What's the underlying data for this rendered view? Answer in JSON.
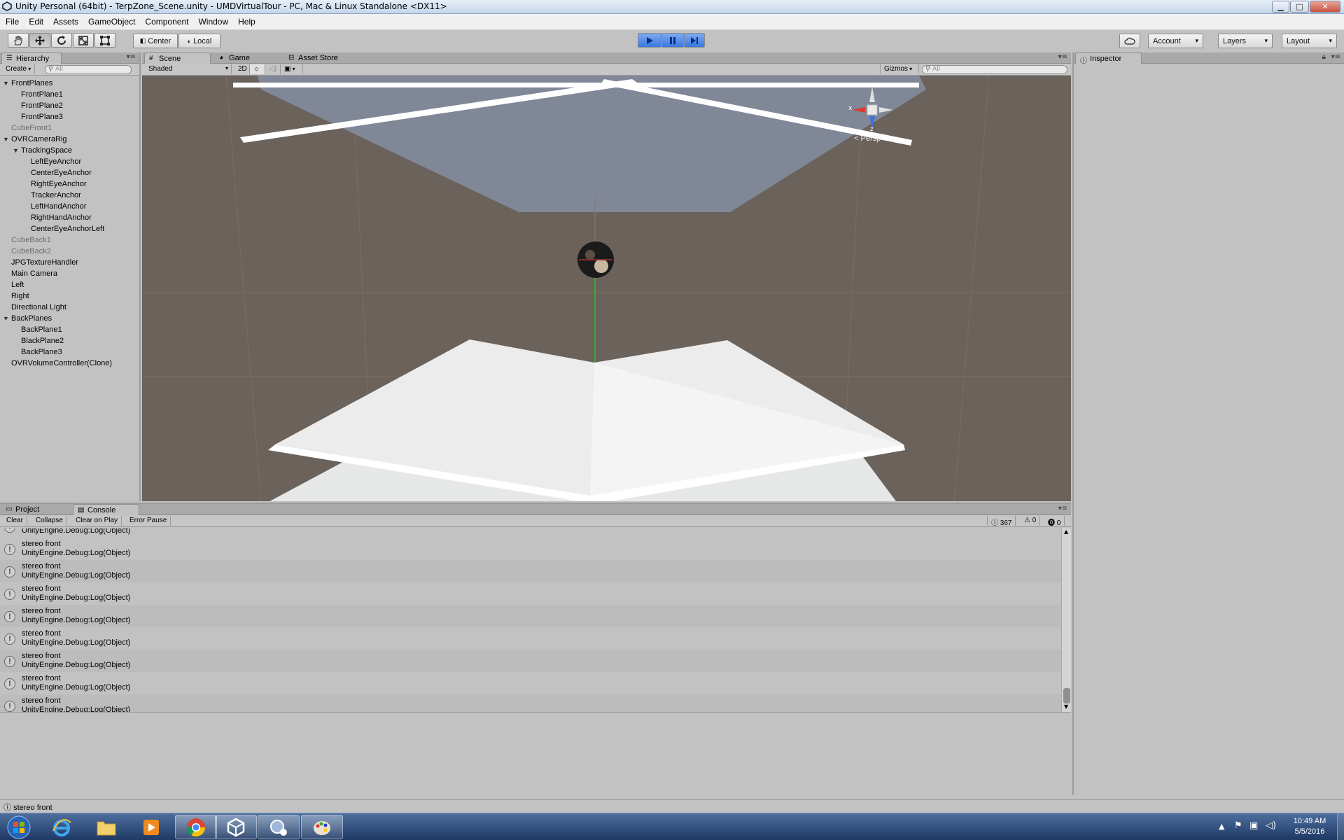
{
  "window": {
    "title": "Unity Personal (64bit) - TerpZone_Scene.unity - UMDVirtualTour - PC, Mac & Linux Standalone <DX11>",
    "controls": {
      "minimize": "▁",
      "maximize": "□",
      "close": "✕"
    }
  },
  "menu": [
    "File",
    "Edit",
    "Assets",
    "GameObject",
    "Component",
    "Window",
    "Help"
  ],
  "toolbar": {
    "tools": [
      "hand-tool",
      "move-tool",
      "rotate-tool",
      "scale-tool",
      "rect-tool"
    ],
    "pivot_mode": "Center",
    "pivot_rotation": "Local",
    "account": "Account",
    "layers": "Layers",
    "layout": "Layout",
    "playing": true
  },
  "hierarchy": {
    "tab": "Hierarchy",
    "create": "Create",
    "search_placeholder": "All",
    "items": [
      {
        "label": "FrontPlanes",
        "depth": 0,
        "expandable": true,
        "dim": false
      },
      {
        "label": "FrontPlane1",
        "depth": 1,
        "expandable": false,
        "dim": false
      },
      {
        "label": "FrontPlane2",
        "depth": 1,
        "expandable": false,
        "dim": false
      },
      {
        "label": "FrontPlane3",
        "depth": 1,
        "expandable": false,
        "dim": false
      },
      {
        "label": "CubeFront1",
        "depth": 0,
        "expandable": false,
        "dim": true
      },
      {
        "label": "OVRCameraRig",
        "depth": 0,
        "expandable": true,
        "dim": false
      },
      {
        "label": "TrackingSpace",
        "depth": 1,
        "expandable": true,
        "dim": false
      },
      {
        "label": "LeftEyeAnchor",
        "depth": 2,
        "expandable": false,
        "dim": false
      },
      {
        "label": "CenterEyeAnchor",
        "depth": 2,
        "expandable": false,
        "dim": false
      },
      {
        "label": "RightEyeAnchor",
        "depth": 2,
        "expandable": false,
        "dim": false
      },
      {
        "label": "TrackerAnchor",
        "depth": 2,
        "expandable": false,
        "dim": false
      },
      {
        "label": "LeftHandAnchor",
        "depth": 2,
        "expandable": false,
        "dim": false
      },
      {
        "label": "RightHandAnchor",
        "depth": 2,
        "expandable": false,
        "dim": false
      },
      {
        "label": "CenterEyeAnchorLeft",
        "depth": 2,
        "expandable": false,
        "dim": false
      },
      {
        "label": "CubeBack1",
        "depth": 0,
        "expandable": false,
        "dim": true
      },
      {
        "label": "CubeBack2",
        "depth": 0,
        "expandable": false,
        "dim": true
      },
      {
        "label": "JPGTextureHandler",
        "depth": 0,
        "expandable": false,
        "dim": false
      },
      {
        "label": "Main Camera",
        "depth": 0,
        "expandable": false,
        "dim": false
      },
      {
        "label": "Left",
        "depth": 0,
        "expandable": false,
        "dim": false
      },
      {
        "label": "Right",
        "depth": 0,
        "expandable": false,
        "dim": false
      },
      {
        "label": "Directional Light",
        "depth": 0,
        "expandable": false,
        "dim": false
      },
      {
        "label": "BackPlanes",
        "depth": 0,
        "expandable": true,
        "dim": false
      },
      {
        "label": "BackPlane1",
        "depth": 1,
        "expandable": false,
        "dim": false
      },
      {
        "label": "BlackPlane2",
        "depth": 1,
        "expandable": false,
        "dim": false
      },
      {
        "label": "BackPlane3",
        "depth": 1,
        "expandable": false,
        "dim": false
      },
      {
        "label": "OVRVolumeController(Clone)",
        "depth": 0,
        "expandable": false,
        "dim": false
      }
    ]
  },
  "scene": {
    "tabs": [
      "Scene",
      "Game",
      "Asset Store"
    ],
    "shading_mode": "Shaded",
    "mode_2d": "2D",
    "gizmos": "Gizmos",
    "search_placeholder": "All",
    "gizmo_labels": {
      "x": "x",
      "z": "z",
      "view": "Persp"
    },
    "colors": {
      "background": "#6b625b",
      "plane_top": "#7f8797",
      "plane_bottom": "#e9eaea"
    }
  },
  "inspector": {
    "tab": "Inspector"
  },
  "console": {
    "tabs": [
      "Project",
      "Console"
    ],
    "buttons": [
      "Clear",
      "Collapse",
      "Clear on Play",
      "Error Pause"
    ],
    "counts": {
      "info": "367",
      "warnings": "0",
      "errors": "0"
    },
    "partial_first_line": "UnityEngine.Debug:Log(Object)",
    "entries": [
      {
        "message": "stereo front",
        "trace": "UnityEngine.Debug:Log(Object)"
      },
      {
        "message": "stereo front",
        "trace": "UnityEngine.Debug:Log(Object)"
      },
      {
        "message": "stereo front",
        "trace": "UnityEngine.Debug:Log(Object)"
      },
      {
        "message": "stereo front",
        "trace": "UnityEngine.Debug:Log(Object)"
      },
      {
        "message": "stereo front",
        "trace": "UnityEngine.Debug:Log(Object)"
      },
      {
        "message": "stereo front",
        "trace": "UnityEngine.Debug:Log(Object)"
      },
      {
        "message": "stereo front",
        "trace": "UnityEngine.Debug:Log(Object)"
      },
      {
        "message": "stereo front",
        "trace": "UnityEngine.Debug:Log(Object)"
      }
    ]
  },
  "statusbar": {
    "message": "stereo front"
  },
  "taskbar": {
    "apps": [
      "start-button",
      "internet-explorer",
      "file-explorer",
      "media-player",
      "chrome",
      "unity",
      "app-7",
      "paint"
    ],
    "clock": {
      "time": "10:49 AM",
      "date": "5/5/2016"
    }
  }
}
